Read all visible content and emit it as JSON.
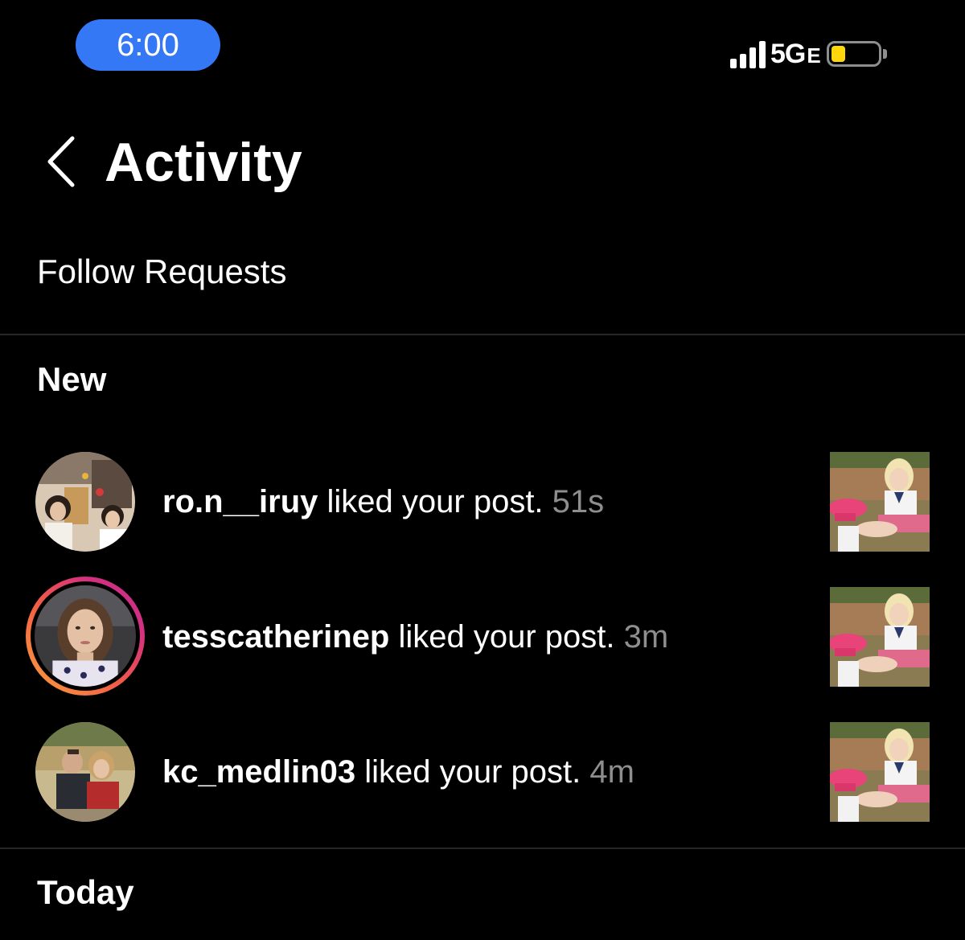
{
  "status_bar": {
    "time": "6:00",
    "network": "5G",
    "network_suffix": "E",
    "battery_level": 0.3,
    "colors": {
      "time_pill": "#3478f6",
      "battery_fill": "#ffd60a"
    }
  },
  "header": {
    "back_icon": "chevron-left-icon",
    "title": "Activity"
  },
  "follow_requests": {
    "label": "Follow Requests"
  },
  "sections": {
    "new": "New",
    "today": "Today"
  },
  "activities": [
    {
      "username": "ro.n__iruy",
      "action": " liked your post. ",
      "time": "51s",
      "has_story": false
    },
    {
      "username": "tesscatherinep",
      "action": " liked your post. ",
      "time": "3m",
      "has_story": true
    },
    {
      "username": "kc_medlin03",
      "action": " liked your post. ",
      "time": "4m",
      "has_story": false
    }
  ]
}
